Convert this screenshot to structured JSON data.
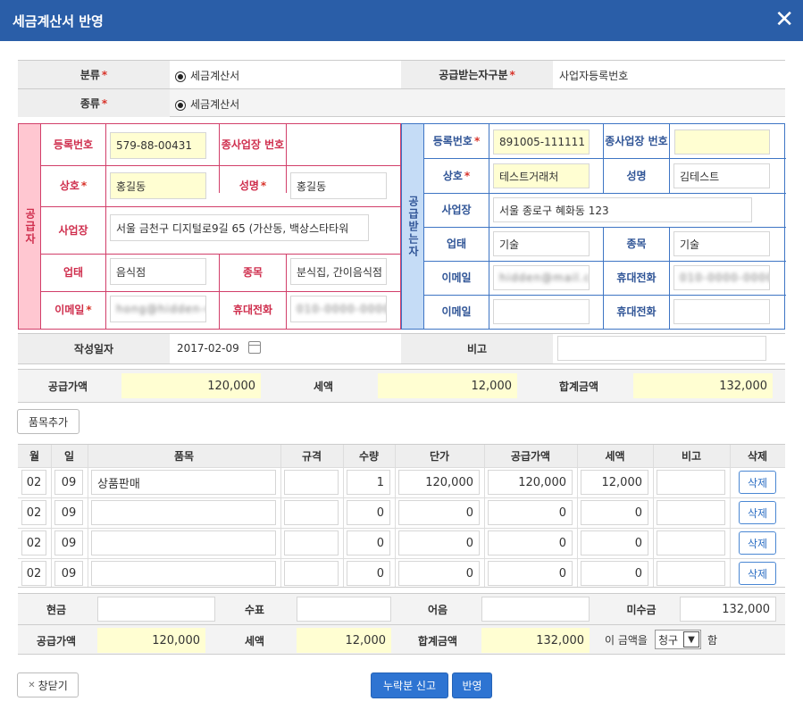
{
  "title": "세금계산서 반영",
  "close_icon": "close-icon",
  "top": {
    "category_label": "분류",
    "category_value": "세금계산서",
    "recipient_type_label": "공급받는자구분",
    "recipient_type_value": "사업자등록번호",
    "kind_label": "종류",
    "kind_value": "세금계산서"
  },
  "supplier": {
    "side_label": "공급자",
    "reg_no_label": "등록번호",
    "reg_no": "579-88-00431",
    "sub_biz_label": "종사업장 번호",
    "sub_biz": "",
    "name_label": "상호",
    "name": "홍길동",
    "rep_label": "성명",
    "rep": "홍길동",
    "address_label": "사업장",
    "address": "서울 금천구 디지털로9길 65 (가산동, 백상스타타워",
    "type_label": "업태",
    "type": "음식점",
    "item_label": "종목",
    "item": "분식집, 간이음식점",
    "email_label": "이메일",
    "email": "hong@hidden-mail.com",
    "phone_label": "휴대전화",
    "phone": "010-0000-0000"
  },
  "buyer": {
    "side_label": "공급받는자",
    "reg_no_label": "등록번호",
    "reg_no": "891005-111111",
    "sub_biz_label": "종사업장 번호",
    "sub_biz": "",
    "name_label": "상호",
    "name": "테스트거래처",
    "rep_label": "성명",
    "rep": "김테스트",
    "address_label": "사업장",
    "address": "서울 종로구 혜화동 123",
    "type_label": "업태",
    "type": "기술",
    "item_label": "종목",
    "item": "기술",
    "email_label": "이메일",
    "email": "hidden@mail.com",
    "phone_label": "휴대전화",
    "phone": "010-0000-0000",
    "email2_label": "이메일",
    "email2": "",
    "phone2_label": "휴대전화",
    "phone2": ""
  },
  "date": {
    "label": "작성일자",
    "value": "2017-02-09",
    "calendar_icon": "calendar-icon",
    "note_label": "비고",
    "note": ""
  },
  "totals": {
    "supply_label": "공급가액",
    "supply": "120,000",
    "tax_label": "세액",
    "tax": "12,000",
    "total_label": "합계금액",
    "total": "132,000"
  },
  "add_item_label": "품목추가",
  "items_table": {
    "headers": [
      "월",
      "일",
      "품목",
      "규격",
      "수량",
      "단가",
      "공급가액",
      "세액",
      "비고",
      "삭제"
    ],
    "delete_label": "삭제",
    "rows": [
      {
        "month": "02",
        "day": "09",
        "item": "상품판매",
        "spec": "",
        "qty": "1",
        "unit_price": "120,000",
        "supply": "120,000",
        "tax": "12,000",
        "note": ""
      },
      {
        "month": "02",
        "day": "09",
        "item": "",
        "spec": "",
        "qty": "0",
        "unit_price": "0",
        "supply": "0",
        "tax": "0",
        "note": ""
      },
      {
        "month": "02",
        "day": "09",
        "item": "",
        "spec": "",
        "qty": "0",
        "unit_price": "0",
        "supply": "0",
        "tax": "0",
        "note": ""
      },
      {
        "month": "02",
        "day": "09",
        "item": "",
        "spec": "",
        "qty": "0",
        "unit_price": "0",
        "supply": "0",
        "tax": "0",
        "note": ""
      }
    ]
  },
  "payment": {
    "cash_label": "현금",
    "cash": "",
    "check_label": "수표",
    "check": "",
    "note_label": "어음",
    "note": "",
    "receivable_label": "미수금",
    "receivable": "132,000",
    "supply_label": "공급가액",
    "supply": "120,000",
    "tax_label": "세액",
    "tax": "12,000",
    "total_label": "합계금액",
    "total": "132,000",
    "amount_prefix": "이 금액을",
    "claim_select": "청구",
    "amount_suffix": "함"
  },
  "footer": {
    "close_label": "창닫기",
    "omission_label": "누락분 신고",
    "apply_label": "반영"
  }
}
